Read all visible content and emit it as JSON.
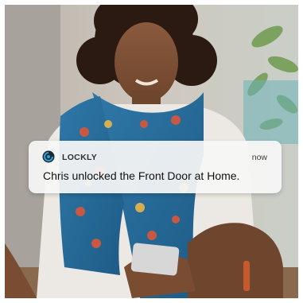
{
  "notification": {
    "app_name": "LOCKLY",
    "time": "now",
    "message": "Chris unlocked the Front Door at Home.",
    "app_icon": "lockly-logo-icon",
    "accent_color": "#2ba3d6"
  },
  "background": {
    "scene": "photo-woman-holding-phone"
  }
}
